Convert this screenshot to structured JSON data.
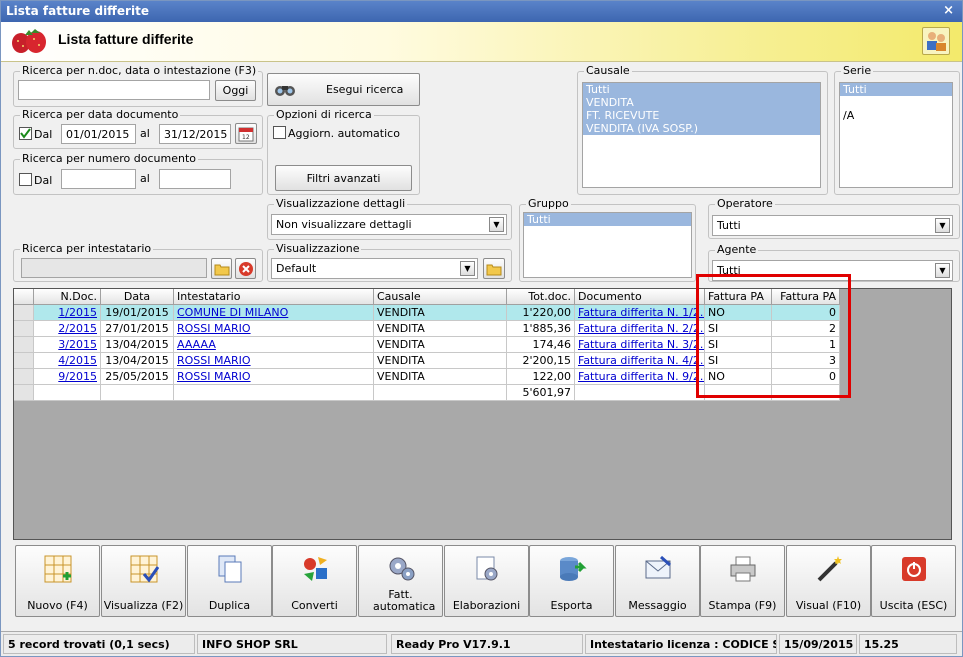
{
  "window": {
    "title": "Lista fatture differite",
    "close_glyph": "×"
  },
  "header": {
    "title": "Lista fatture differite",
    "logo_icon": "strawberry-icon",
    "user_icon": "users-icon"
  },
  "search": {
    "ndoc_label": "Ricerca per n.doc, data o intestazione (F3)",
    "ndoc_value": "",
    "oggi_label": "Oggi",
    "esegui_label": "Esegui ricerca",
    "date_label": "Ricerca per data documento",
    "date_dal_label": "Dal",
    "date_from": "01/01/2015",
    "date_al_label": "al",
    "date_to": "31/12/2015",
    "date_dal_checked": true,
    "num_label": "Ricerca per numero documento",
    "num_dal_label": "Dal",
    "num_from": "",
    "num_al_label": "al",
    "num_to": "",
    "num_dal_checked": false,
    "intest_label": "Ricerca per intestatario",
    "intest_value": ""
  },
  "options": {
    "label": "Opzioni di ricerca",
    "auto_label": "Aggiorn. automatico",
    "auto_checked": false,
    "filtri_label": "Filtri avanzati"
  },
  "causale": {
    "label": "Causale",
    "items": [
      "Tutti",
      "VENDITA",
      "FT. RICEVUTE",
      "VENDITA (IVA SOSP.)"
    ]
  },
  "serie": {
    "label": "Serie",
    "items": [
      "Tutti",
      "",
      "/A"
    ]
  },
  "dettagli": {
    "label": "Visualizzazione dettagli",
    "value": "Non visualizzare dettagli"
  },
  "visualizzazione": {
    "label": "Visualizzazione",
    "value": "Default"
  },
  "gruppo": {
    "label": "Gruppo",
    "items": [
      "Tutti"
    ]
  },
  "operatore": {
    "label": "Operatore",
    "value": "Tutti"
  },
  "agente": {
    "label": "Agente",
    "value": "Tutti"
  },
  "table": {
    "columns": [
      "N.Doc.",
      "Data",
      "Intestatario",
      "Causale",
      "Tot.doc.",
      "Documento",
      "Fattura PA",
      "Fattura PA"
    ],
    "rows": [
      [
        "1/2015",
        "19/01/2015",
        "COMUNE DI MILANO",
        "VENDITA",
        "1'220,00",
        "Fattura differita N. 1/2...",
        "NO",
        "0"
      ],
      [
        "2/2015",
        "27/01/2015",
        "ROSSI MARIO",
        "VENDITA",
        "1'885,36",
        "Fattura differita N. 2/2...",
        "SI",
        "2"
      ],
      [
        "3/2015",
        "13/04/2015",
        "AAAAA",
        "VENDITA",
        "174,46",
        "Fattura differita N. 3/2...",
        "SI",
        "1"
      ],
      [
        "4/2015",
        "13/04/2015",
        "ROSSI MARIO",
        "VENDITA",
        "2'200,15",
        "Fattura differita N. 4/2...",
        "SI",
        "3"
      ],
      [
        "9/2015",
        "25/05/2015",
        "ROSSI MARIO",
        "VENDITA",
        "122,00",
        "Fattura differita N. 9/2...",
        "NO",
        "0"
      ]
    ],
    "total": "5'601,97"
  },
  "toolbar": [
    {
      "label": "Nuovo (F4)",
      "icon": "new-grid-icon"
    },
    {
      "label": "Visualizza (F2)",
      "icon": "view-grid-icon"
    },
    {
      "label": "Duplica",
      "icon": "duplicate-icon"
    },
    {
      "label": "Converti",
      "icon": "convert-icon"
    },
    {
      "label": "Fatt. automatica",
      "icon": "auto-invoice-icon"
    },
    {
      "label": "Elaborazioni",
      "icon": "gear-doc-icon"
    },
    {
      "label": "Esporta",
      "icon": "export-icon"
    },
    {
      "label": "Messaggio",
      "icon": "message-icon"
    },
    {
      "label": "Stampa (F9)",
      "icon": "printer-icon"
    },
    {
      "label": "Visual (F10)",
      "icon": "magic-wand-icon"
    },
    {
      "label": "Uscita (ESC)",
      "icon": "power-icon"
    }
  ],
  "status": {
    "records": "5 record trovati (0,1 secs)",
    "company": "INFO SHOP SRL",
    "version": "Ready Pro V17.9.1",
    "license": "Intestatario licenza : CODICE SRL",
    "date": "15/09/2015",
    "time": "15.25"
  },
  "colors": {
    "selected_row": "#b0e8ec",
    "list_selection": "#9ab7de",
    "highlight_box": "#e00000",
    "link": "#0000d0"
  }
}
